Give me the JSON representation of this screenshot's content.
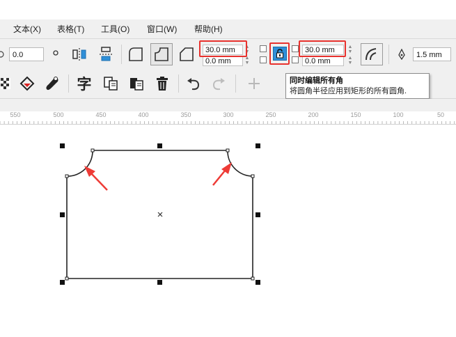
{
  "menu": {
    "items": [
      "文本(X)",
      "表格(T)",
      "工具(O)",
      "窗口(W)",
      "帮助(H)"
    ]
  },
  "property_bar": {
    "left_value": "0.0",
    "corner_top_left": "30.0 mm",
    "corner_bottom_left": "0.0 mm",
    "corner_top_right": "30.0 mm",
    "corner_bottom_right": "0.0 mm",
    "outline_width": "1.5 mm"
  },
  "tooltip": {
    "title": "同时编辑所有角",
    "body": "将圆角半径应用到矩形的所有圆角."
  },
  "ruler": {
    "labels": [
      "550",
      "500",
      "450",
      "400",
      "350",
      "300",
      "250",
      "200",
      "150",
      "100",
      "50"
    ]
  },
  "colors": {
    "highlight": "#e8322e",
    "arrow": "#ee3b36",
    "lock_button_fill": "#2f8fd8",
    "shape_stroke": "#222222"
  },
  "icons": [
    "checkerboard-icon",
    "fill-bucket-icon",
    "eyedropper-icon",
    "text-tool-icon",
    "copy-properties-icon",
    "paste-icon",
    "delete-icon",
    "undo-icon",
    "redo-icon",
    "add-icon",
    "lock-icon",
    "corner-round-icon",
    "corner-scallop-icon",
    "corner-chamfer-icon",
    "pen-nib-icon",
    "scale-corners-icon"
  ]
}
